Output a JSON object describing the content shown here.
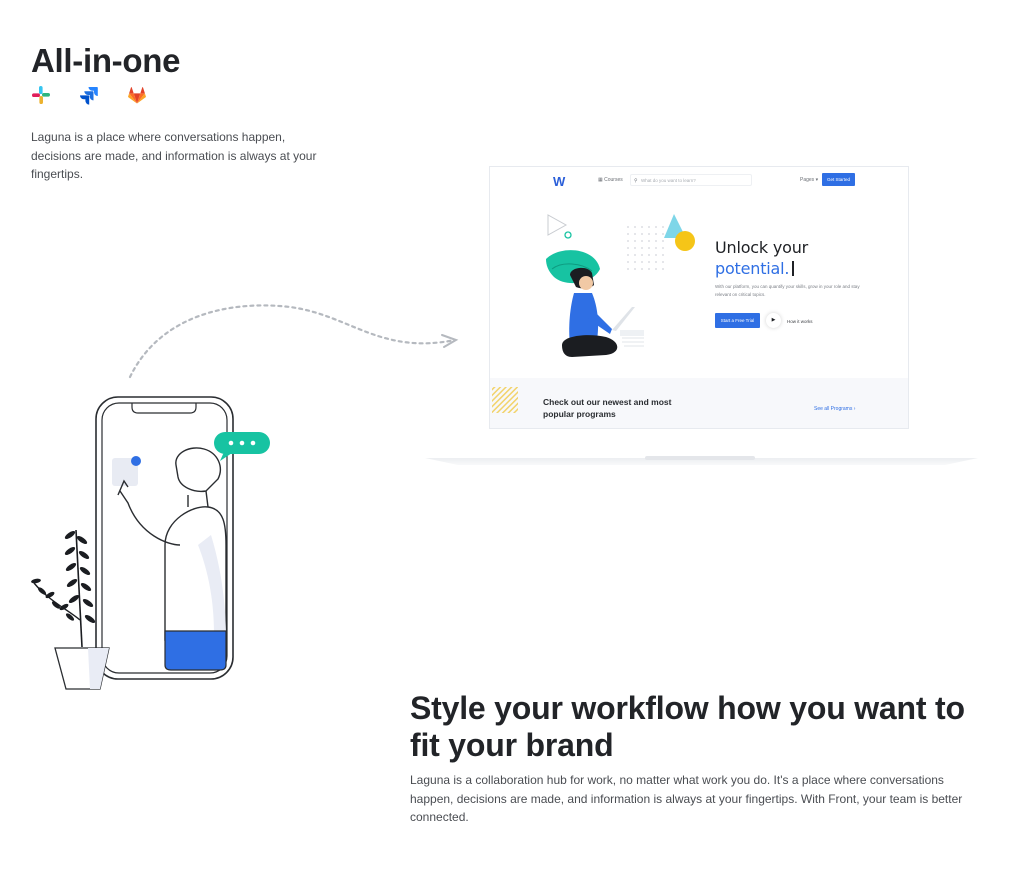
{
  "all_in_one": {
    "title": "All-in-one",
    "icons": [
      "slack-icon",
      "jira-icon",
      "gitlab-icon"
    ],
    "description": "Laguna is a place where conversations happen, decisions are made, and information is always at your fingertips."
  },
  "mockup": {
    "nav": {
      "logo": "W",
      "courses": "▦ Courses",
      "search_placeholder": "What do you want to learn?",
      "pages": "Pages ▾",
      "cta": "Get Started"
    },
    "hero": {
      "headline_1": "Unlock your",
      "headline_2": "potential.",
      "subtext": "With our platform, you can quantify your skills, grow in your role and stay relevant on critical topics.",
      "trial_button": "Start a Free Trial",
      "play_glyph": "▶",
      "how_it_works": "How it works"
    },
    "programs": {
      "heading": "Check out our newest and most popular programs",
      "see_all": "See all Programs ›"
    }
  },
  "workflow": {
    "title": "Style your workflow how you want to fit your brand",
    "description": "Laguna is a collaboration hub for work, no matter what work you do. It's a place where conversations happen, decisions are made, and information is always at your fingertips. With Front, your team is better connected."
  },
  "colors": {
    "accent": "#2f6fe4",
    "teal": "#17c3a2",
    "yellow": "#f5c518",
    "text_dark": "#222428",
    "text_body": "#4a4d52"
  }
}
